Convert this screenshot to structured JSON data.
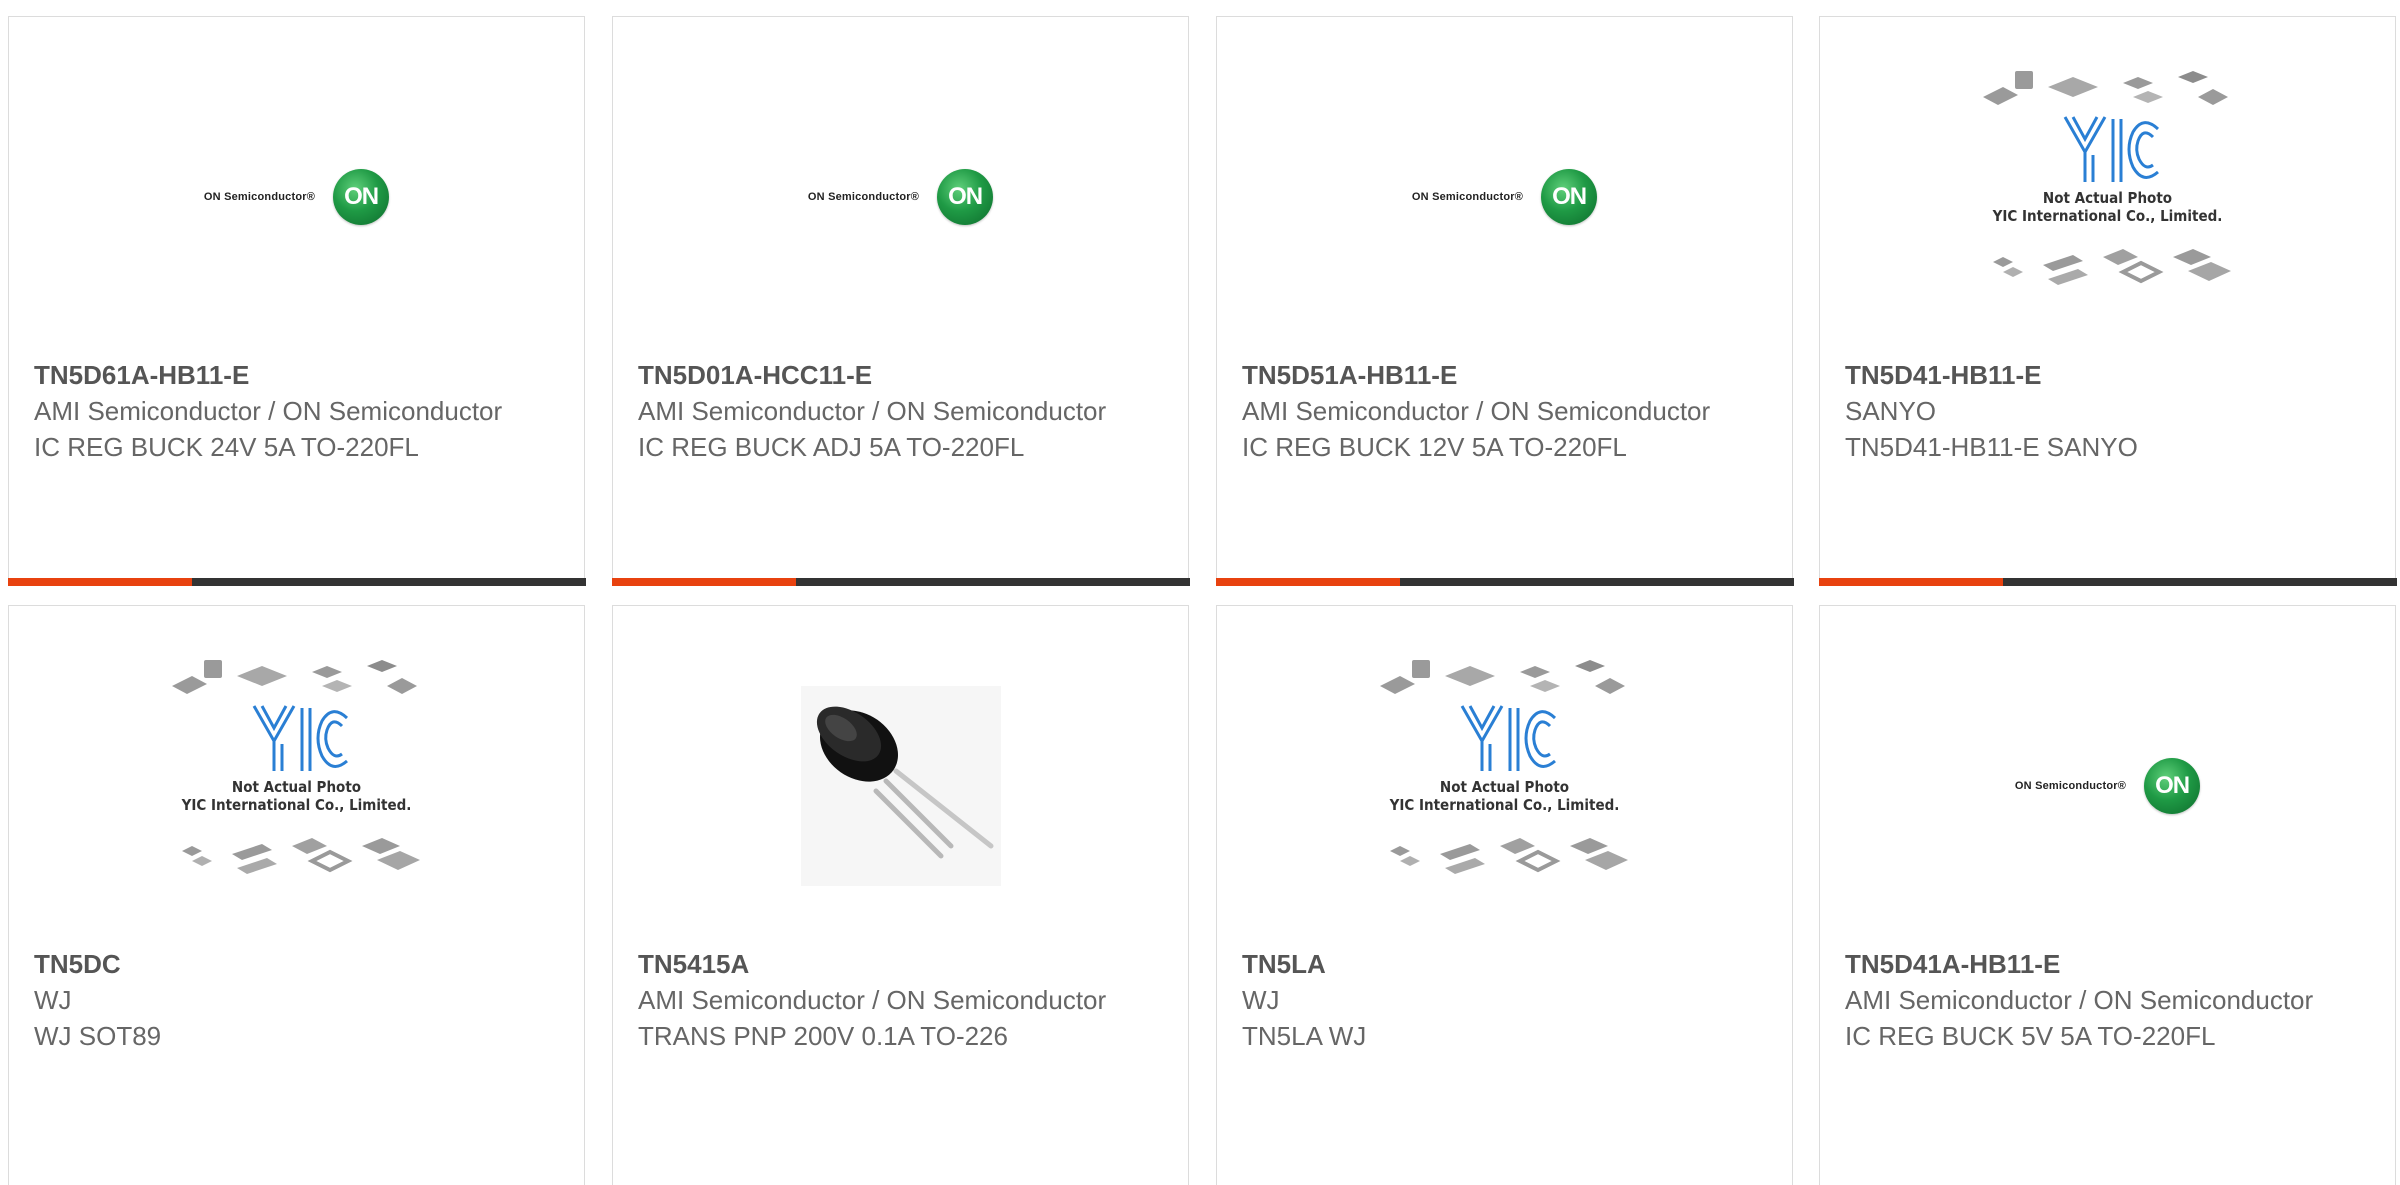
{
  "logos": {
    "on_text": "ON Semiconductor®",
    "on_mark": "ON",
    "yic_line1": "Not Actual Photo",
    "yic_line2": "YIC International Co., Limited."
  },
  "colors": {
    "accent": "#e8420f",
    "bar_dark": "#333333",
    "on_green": "#1f9a45",
    "yic_blue": "#2a7fd4"
  },
  "products": [
    {
      "part": "TN5D61A-HB11-E",
      "mfr": "AMI Semiconductor / ON Semiconductor",
      "desc": "IC REG BUCK 24V 5A TO-220FL",
      "image": "on-semiconductor-logo"
    },
    {
      "part": "TN5D01A-HCC11-E",
      "mfr": "AMI Semiconductor / ON Semiconductor",
      "desc": "IC REG BUCK ADJ 5A TO-220FL",
      "image": "on-semiconductor-logo"
    },
    {
      "part": "TN5D51A-HB11-E",
      "mfr": "AMI Semiconductor / ON Semiconductor",
      "desc": "IC REG BUCK 12V 5A TO-220FL",
      "image": "on-semiconductor-logo"
    },
    {
      "part": "TN5D41-HB11-E",
      "mfr": "SANYO",
      "desc": "TN5D41-HB11-E SANYO",
      "image": "yic-placeholder"
    },
    {
      "part": "TN5DC",
      "mfr": "WJ",
      "desc": "WJ SOT89",
      "image": "yic-placeholder"
    },
    {
      "part": "TN5415A",
      "mfr": "AMI Semiconductor / ON Semiconductor",
      "desc": "TRANS PNP 200V 0.1A TO-226",
      "image": "transistor-photo"
    },
    {
      "part": "TN5LA",
      "mfr": "WJ",
      "desc": "TN5LA WJ",
      "image": "yic-placeholder"
    },
    {
      "part": "TN5D41A-HB11-E",
      "mfr": "AMI Semiconductor / ON Semiconductor",
      "desc": "IC REG BUCK 5V 5A TO-220FL",
      "image": "on-semiconductor-logo"
    }
  ]
}
